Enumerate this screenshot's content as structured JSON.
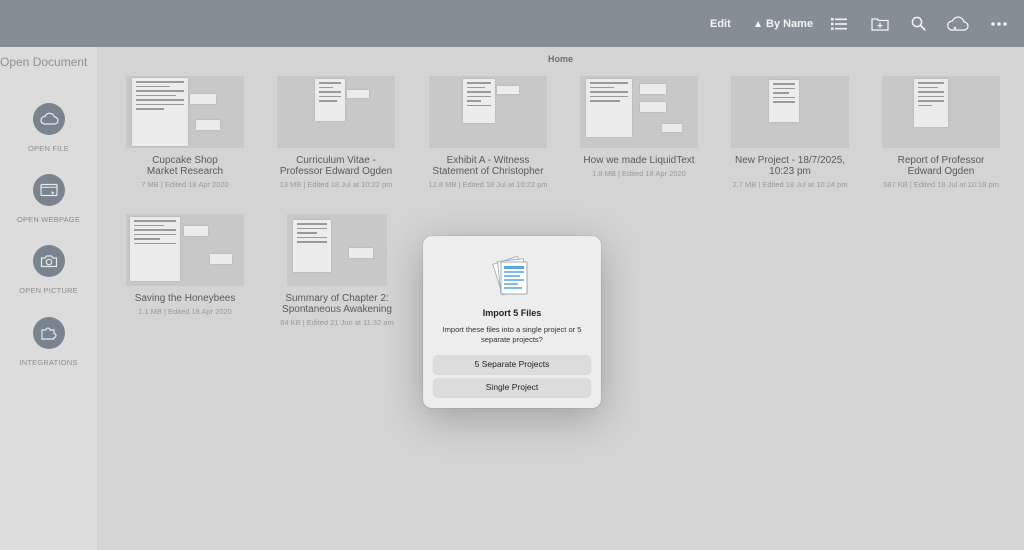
{
  "toolbar": {
    "edit_label": "Edit",
    "sort_label": "By Name",
    "sort_icon": "triangle-up-icon",
    "icons": [
      "list-view-icon",
      "new-folder-icon",
      "search-icon",
      "cloud-sync-icon",
      "more-icon"
    ]
  },
  "sidebar": {
    "title": "Open Document",
    "items": [
      {
        "label": "OPEN FILE",
        "icon": "cloud-icon"
      },
      {
        "label": "OPEN WEBPAGE",
        "icon": "webpage-icon"
      },
      {
        "label": "OPEN PICTURE",
        "icon": "camera-icon"
      },
      {
        "label": "INTEGRATIONS",
        "icon": "puzzle-icon"
      }
    ]
  },
  "main": {
    "title": "Home",
    "documents": [
      {
        "title": "Cupcake Shop\nMarket Research",
        "meta": "7 MB | Edited 18 Apr 2020"
      },
      {
        "title": "Curriculum Vitae -\nProfessor Edward Ogden",
        "meta": "13 MB | Edited 18 Jul at 10:22 pm"
      },
      {
        "title": "Exhibit A - Witness\nStatement of Christopher",
        "meta": "12.8 MB | Edited 18 Jul at 10:22 pm"
      },
      {
        "title": "How we made LiquidText",
        "meta": "1.8 MB | Edited 18 Apr 2020"
      },
      {
        "title": "New Project - 18/7/2025,\n10:23 pm",
        "meta": "2.7 MB | Edited 18 Jul at 10:24 pm"
      },
      {
        "title": "Report of Professor\nEdward Ogden",
        "meta": "587 KB | Edited 18 Jul at 10:18 pm"
      },
      {
        "title": "Saving the Honeybees",
        "meta": "1.1 MB | Edited 18 Apr 2020"
      },
      {
        "title": "Summary of Chapter 2:\nSpontaneous Awakening",
        "meta": "64 KB | Edited 21 Jun at 11:32 am"
      }
    ]
  },
  "dialog": {
    "title": "Import 5 Files",
    "message": "Import these files into a single project or 5 separate projects?",
    "option_separate": "5 Separate Projects",
    "option_single": "Single Project"
  }
}
